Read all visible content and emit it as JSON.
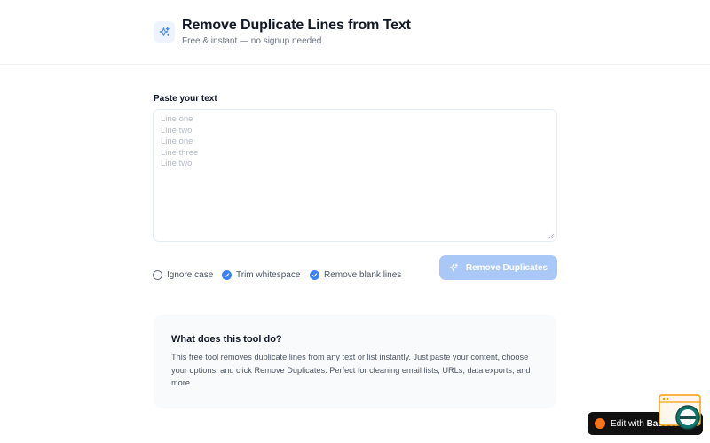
{
  "header": {
    "title": "Remove Duplicate Lines from Text",
    "subtitle": "Free & instant — no signup needed",
    "logo_icon": "sparkles-icon"
  },
  "input": {
    "label": "Paste your text",
    "value": "",
    "placeholder": "Line one\nLine two\nLine one\nLine three\nLine two"
  },
  "options": [
    {
      "label": "Ignore case",
      "checked": false
    },
    {
      "label": "Trim whitespace",
      "checked": true
    },
    {
      "label": "Remove blank lines",
      "checked": true
    }
  ],
  "action": {
    "label": "Remove Duplicates",
    "icon": "sparkles-icon",
    "disabled": true
  },
  "info": {
    "title": "What does this tool do?",
    "body": "This free tool removes duplicate lines from any text or list instantly. Just paste your content, choose your options, and click Remove Duplicates. Perfect for cleaning email lists, URLs, data exports, and more."
  },
  "badge": {
    "prefix": "Edit with",
    "brand": "Base44"
  },
  "colors": {
    "accent": "#3b82f6",
    "button_disabled": "#a9c8f7",
    "badge_bg": "#111111",
    "badge_dot": "#f97316"
  }
}
